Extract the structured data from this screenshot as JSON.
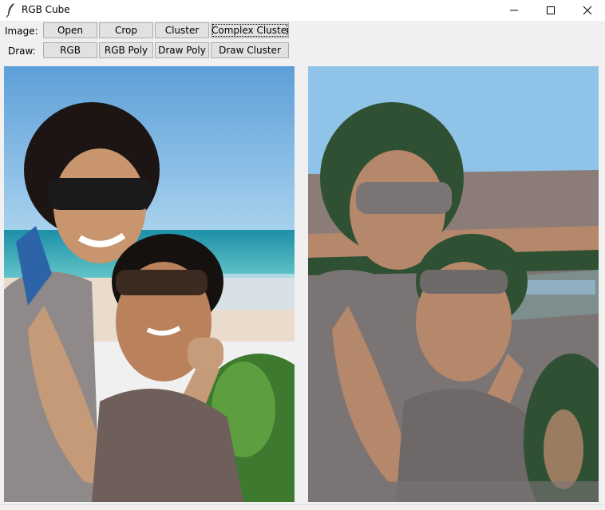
{
  "window": {
    "title": "RGB Cube",
    "icon": "feather-icon",
    "controls": [
      "minimize-icon",
      "maximize-icon",
      "close-icon"
    ]
  },
  "toolbar": {
    "image_label": "Image:",
    "draw_label": "Draw:",
    "image_buttons": [
      "Open",
      "Crop",
      "Cluster",
      "Complex Cluster"
    ],
    "draw_buttons": [
      "RGB",
      "RGB Poly",
      "Draw Poly",
      "Draw Cluster"
    ]
  },
  "panels": {
    "original": "photo: couple on beach",
    "clustered": "posterized cluster result"
  },
  "colors": {
    "sky": "#8fc3e8",
    "sea": "#3aa6b4",
    "skin": "#b78a6b",
    "cluster_green": "#2f5032",
    "cluster_gray": "#7b7474",
    "cluster_tan": "#c1a898"
  }
}
